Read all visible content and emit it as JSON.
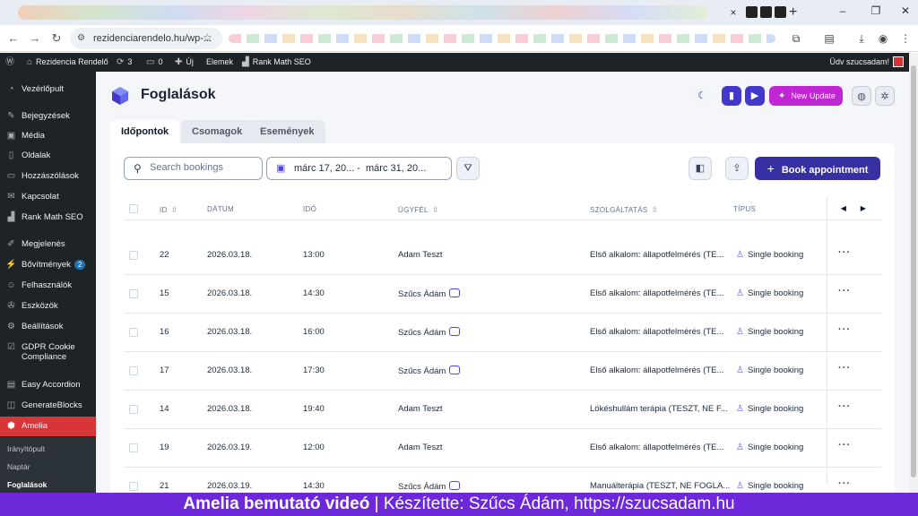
{
  "browser": {
    "url": "rezidenciarendelo.hu/wp-...",
    "tab_close": "×",
    "new_tab": "+"
  },
  "adminbar": {
    "site_name": "Rezidencia Rendelő",
    "updates_count": "3",
    "comments_count": "0",
    "new_label": "Új",
    "elements_label": "Elemek",
    "rankmath_label": "Rank Math SEO",
    "greeting": "Üdv szucsadam!"
  },
  "sidebar": {
    "items": [
      {
        "label": "Vezérlőpult",
        "icon": "dashboard-icon"
      },
      {
        "label": "Bejegyzések",
        "icon": "pin-icon"
      },
      {
        "label": "Média",
        "icon": "media-icon"
      },
      {
        "label": "Oldalak",
        "icon": "pages-icon"
      },
      {
        "label": "Hozzászólások",
        "icon": "comments-icon"
      },
      {
        "label": "Kapcsolat",
        "icon": "mail-icon"
      },
      {
        "label": "Rank Math SEO",
        "icon": "chart-icon"
      },
      {
        "label": "Megjelenés",
        "icon": "brush-icon"
      },
      {
        "label": "Bővítmények",
        "icon": "plugin-icon",
        "badge": "2"
      },
      {
        "label": "Felhasználók",
        "icon": "users-icon"
      },
      {
        "label": "Eszközök",
        "icon": "wrench-icon"
      },
      {
        "label": "Beállítások",
        "icon": "settings-icon"
      },
      {
        "label": "GDPR Cookie",
        "label2": "Compliance",
        "icon": "check-icon"
      },
      {
        "label": "Easy Accordion",
        "icon": "accordion-icon"
      },
      {
        "label": "GenerateBlocks",
        "icon": "blocks-icon"
      },
      {
        "label": "Amelia",
        "icon": "amelia-icon"
      }
    ],
    "submenu": [
      "Irányítópult",
      "Naptár",
      "Foglalások"
    ]
  },
  "page": {
    "title": "Foglalások",
    "new_update": "New Update",
    "tabs": [
      "Időpontok",
      "Csomagok",
      "Események"
    ],
    "search_placeholder": "Search bookings",
    "date_from": "márc 17, 20...",
    "date_sep": "-",
    "date_to": "márc 31, 20...",
    "book_button": "Book appointment",
    "columns": {
      "id": "ID",
      "date": "DÁTUM",
      "time": "IDŐ",
      "client": "ÜGYFÉL",
      "service": "SZOLGÁLTATÁS",
      "type": "TÍPUS"
    },
    "rows": [
      {
        "id": "22",
        "date": "2026.03.18.",
        "time": "13:00",
        "client": "Adam Teszt",
        "note": false,
        "service": "Első alkalom: állapotfelmérés (TE...",
        "type": "Single booking"
      },
      {
        "id": "15",
        "date": "2026.03.18.",
        "time": "14:30",
        "client": "Szűcs Ádám",
        "note": true,
        "service": "Első alkalom: állapotfelmérés (TE...",
        "type": "Single booking"
      },
      {
        "id": "16",
        "date": "2026.03.18.",
        "time": "16:00",
        "client": "Szűcs Ádám",
        "note": true,
        "service": "Első alkalom: állapotfelmérés (TE...",
        "type": "Single booking"
      },
      {
        "id": "17",
        "date": "2026.03.18.",
        "time": "17:30",
        "client": "Szűcs Ádám",
        "note": true,
        "service": "Első alkalom: állapotfelmérés (TE...",
        "type": "Single booking"
      },
      {
        "id": "14",
        "date": "2026.03.18.",
        "time": "19:40",
        "client": "Adam Teszt",
        "note": false,
        "service": "Lökéshullám terápia (TESZT, NE F...",
        "type": "Single booking"
      },
      {
        "id": "19",
        "date": "2026.03.19.",
        "time": "12:00",
        "client": "Adam Teszt",
        "note": false,
        "service": "Első alkalom: állapotfelmérés (TE...",
        "type": "Single booking"
      },
      {
        "id": "21",
        "date": "2026.03.19.",
        "time": "14:30",
        "client": "Szűcs Ádám",
        "note": true,
        "service": "Manuálterápia (TESZT, NE FOGLA...",
        "type": "Single booking"
      }
    ]
  },
  "banner": {
    "title": "Amelia bemutató videó",
    "rest": " | Készítette: Szűcs Ádám, https://szucsadam.hu"
  },
  "colors": {
    "accent": "#3730a3",
    "wp_dark": "#1d2327",
    "wp_active": "#d63638",
    "update_pink": "#c026d3",
    "banner": "#6d28d9"
  }
}
